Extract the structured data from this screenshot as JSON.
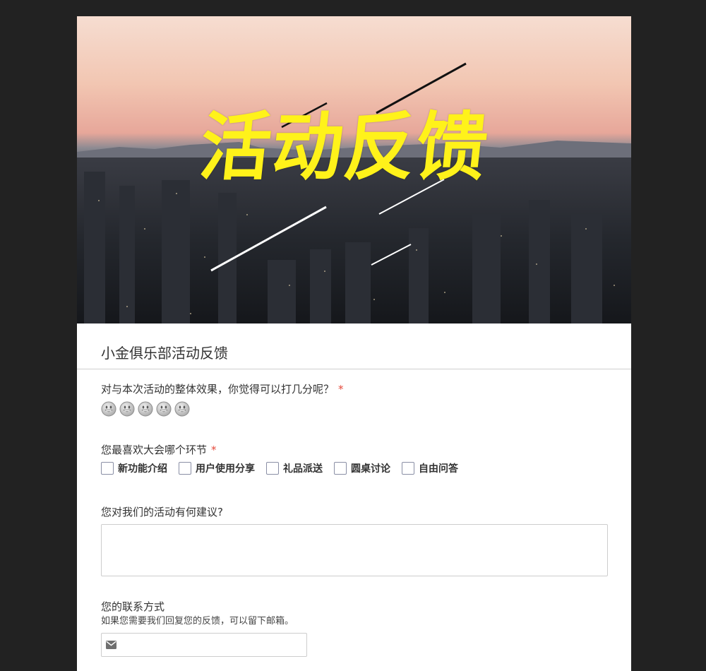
{
  "banner": {
    "title": "活动反馈"
  },
  "form": {
    "title": "小金俱乐部活动反馈"
  },
  "questions": {
    "q1": {
      "label": "对与本次活动的整体效果，你觉得可以打几分呢？",
      "required_mark": "*",
      "rating_max": 5,
      "rating_value": 0,
      "rating_icon": "smiley-face-icon"
    },
    "q2": {
      "label": "您最喜欢大会哪个环节",
      "required_mark": "*",
      "options": [
        "新功能介绍",
        "用户使用分享",
        "礼品派送",
        "圆桌讨论",
        "自由问答"
      ]
    },
    "q3": {
      "label": "您对我们的活动有何建议?",
      "value": ""
    },
    "q4": {
      "label": "您的联系方式",
      "description": "如果您需要我们回复您的反馈，可以留下邮箱。",
      "value": "",
      "icon": "envelope-icon"
    }
  },
  "colors": {
    "page_background": "#222222",
    "banner_title": "#fff21a",
    "required": "#e5493b"
  }
}
